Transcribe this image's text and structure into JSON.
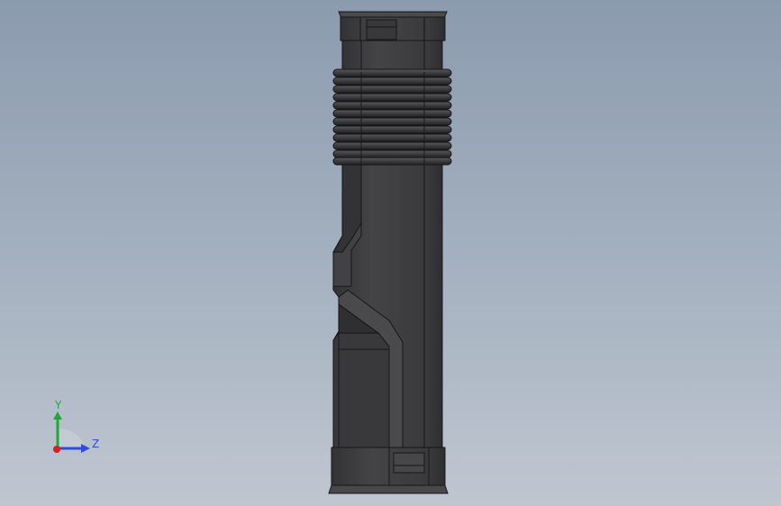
{
  "viewport": {
    "part_color": "#3e3e40",
    "part_edge_color": "#161618",
    "part_highlight_color": "#4d4d50",
    "part_shadow_color": "#303032"
  },
  "triad": {
    "y_label": "Y",
    "z_label": "Z",
    "y_color": "#1ea83a",
    "z_color": "#2d4fd6",
    "x_color": "#d81e1e",
    "y_icon": "y-axis-arrow-icon",
    "z_icon": "z-axis-arrow-icon",
    "x_icon": "x-axis-origin-icon"
  }
}
